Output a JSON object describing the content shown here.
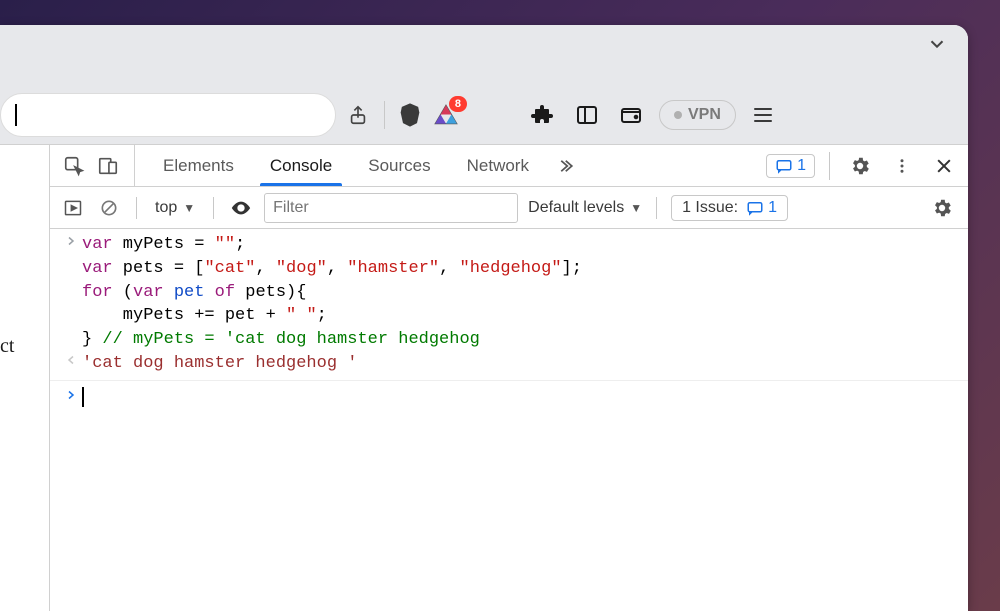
{
  "browser": {
    "rewards_badge": "8",
    "vpn_label": "VPN"
  },
  "devtools": {
    "tabs": {
      "elements": "Elements",
      "console": "Console",
      "sources": "Sources",
      "network": "Network"
    },
    "issues_chip_count": "1",
    "console_toolbar": {
      "context": "top",
      "filter_placeholder": "Filter",
      "levels": "Default levels",
      "issue_label": "1 Issue:",
      "issue_count": "1"
    },
    "console": {
      "code_lines": [
        {
          "segments": [
            {
              "t": "kw",
              "v": "var"
            },
            {
              "t": "op",
              "v": " myPets = "
            },
            {
              "t": "str",
              "v": "\"\""
            },
            {
              "t": "op",
              "v": ";"
            }
          ]
        },
        {
          "segments": [
            {
              "t": "kw",
              "v": "var"
            },
            {
              "t": "op",
              "v": " pets = ["
            },
            {
              "t": "str",
              "v": "\"cat\""
            },
            {
              "t": "op",
              "v": ", "
            },
            {
              "t": "str",
              "v": "\"dog\""
            },
            {
              "t": "op",
              "v": ", "
            },
            {
              "t": "str",
              "v": "\"hamster\""
            },
            {
              "t": "op",
              "v": ", "
            },
            {
              "t": "str",
              "v": "\"hedgehog\""
            },
            {
              "t": "op",
              "v": "];"
            }
          ]
        },
        {
          "segments": [
            {
              "t": "kw",
              "v": "for"
            },
            {
              "t": "op",
              "v": " ("
            },
            {
              "t": "kw",
              "v": "var"
            },
            {
              "t": "op",
              "v": " "
            },
            {
              "t": "ident",
              "v": "pet"
            },
            {
              "t": "op",
              "v": " "
            },
            {
              "t": "kw",
              "v": "of"
            },
            {
              "t": "op",
              "v": " pets){"
            }
          ]
        },
        {
          "segments": [
            {
              "t": "op",
              "v": "    myPets += pet + "
            },
            {
              "t": "str",
              "v": "\" \""
            },
            {
              "t": "op",
              "v": ";"
            }
          ]
        },
        {
          "segments": [
            {
              "t": "op",
              "v": "} "
            },
            {
              "t": "comment",
              "v": "// myPets = 'cat dog hamster hedgehog"
            }
          ]
        }
      ],
      "output": "'cat dog hamster hedgehog '"
    }
  },
  "page_fragment": "ct"
}
